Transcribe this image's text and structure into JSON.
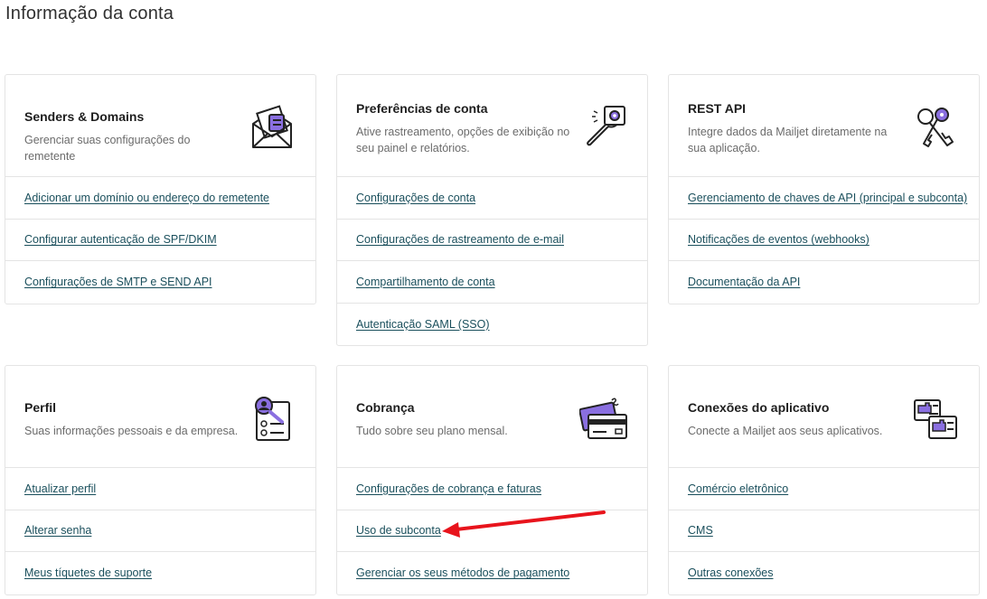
{
  "page": {
    "title": "Informação da conta"
  },
  "cards": {
    "senders": {
      "title": "Senders & Domains",
      "desc": "Gerenciar suas configurações do remetente",
      "icon": "envelope-letter-icon",
      "links": [
        "Adicionar um domínio ou endereço do remetente",
        "Configurar autenticação de SPF/DKIM",
        "Configurações de SMTP e SEND API"
      ]
    },
    "preferences": {
      "title": "Preferências de conta",
      "desc": "Ative rastreamento, opções de exibição no seu painel e relatórios.",
      "icon": "wrench-gear-icon",
      "links": [
        "Configurações de conta",
        "Configurações de rastreamento de e-mail",
        "Compartilhamento de conta",
        "Autenticação SAML (SSO)"
      ]
    },
    "rest_api": {
      "title": "REST API",
      "desc": "Integre dados da Mailjet diretamente na sua aplicação.",
      "icon": "keys-icon",
      "links": [
        "Gerenciamento de chaves de API (principal e subconta)",
        "Notificações de eventos (webhooks)",
        "Documentação da API"
      ]
    },
    "profile": {
      "title": "Perfil",
      "desc": "Suas informações pessoais e da empresa.",
      "icon": "profile-magnifier-icon",
      "links": [
        "Atualizar perfil",
        "Alterar senha",
        "Meus tíquetes de suporte"
      ]
    },
    "billing": {
      "title": "Cobrança",
      "desc": "Tudo sobre seu plano mensal.",
      "icon": "credit-card-icon",
      "links": [
        "Configurações de cobrança e faturas",
        "Uso de subconta",
        "Gerenciar os seus métodos de pagamento"
      ]
    },
    "connections": {
      "title": "Conexões do aplicativo",
      "desc": "Conecte a Mailjet aos seus aplicativos.",
      "icon": "puzzle-connections-icon",
      "links": [
        "Comércio eletrônico",
        "CMS",
        "Outras conexões"
      ]
    }
  },
  "annotation": {
    "arrow_color": "#e8141c"
  },
  "colors": {
    "accent_purple": "#8a6fe0",
    "link": "#1a4f5c"
  }
}
